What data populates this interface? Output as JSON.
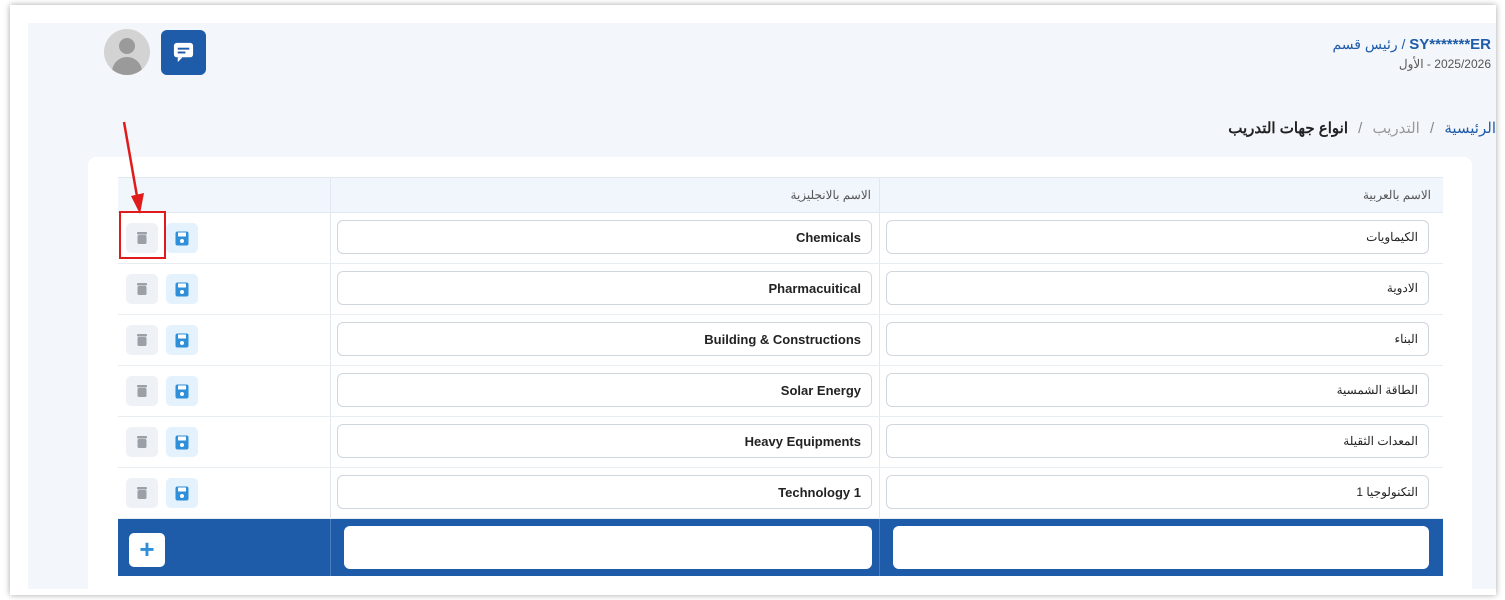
{
  "header": {
    "username": "SY*******ER",
    "role": " / رئيس قسم",
    "term": "2025/2026 - الأول"
  },
  "breadcrumb": {
    "home": "الرئيسية",
    "section": "التدريب",
    "current": "انواع جهات التدريب",
    "separator": "/"
  },
  "table": {
    "columns": {
      "arabic_name": "الاسم بالعربية",
      "english_name": "الاسم بالانجليزية"
    },
    "rows": [
      {
        "ar": "الكيماويات",
        "en": "Chemicals"
      },
      {
        "ar": "الادوية",
        "en": "Pharmacuitical"
      },
      {
        "ar": "البناء",
        "en": "Building & Constructions"
      },
      {
        "ar": "الطاقة الشمسية",
        "en": "Solar Energy"
      },
      {
        "ar": "المعدات الثقيلة",
        "en": "Heavy Equipments"
      },
      {
        "ar": "التكنولوجيا 1",
        "en": "Technology 1"
      }
    ],
    "new_row": {
      "ar": "",
      "en": "",
      "add_label": "+"
    }
  },
  "icons": {
    "delete": "trash-icon",
    "save": "save-icon",
    "chat": "chat-icon",
    "avatar": "user-avatar-icon"
  },
  "colors": {
    "primary": "#1e5ba8",
    "save_icon": "#2f8fd8",
    "delete_icon": "#9aa0a6",
    "annotation": "#e01b1b"
  }
}
